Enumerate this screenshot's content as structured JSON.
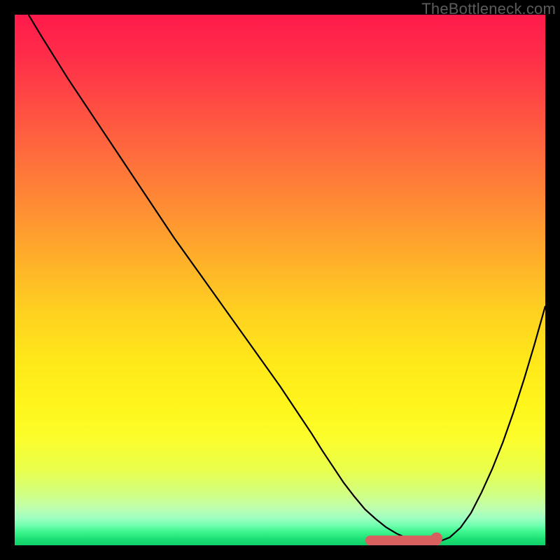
{
  "watermark": "TheBottleneck.com",
  "gradient": {
    "stops": [
      {
        "offset": 0.0,
        "color": "#ff1a4b"
      },
      {
        "offset": 0.08,
        "color": "#ff2e49"
      },
      {
        "offset": 0.16,
        "color": "#ff4944"
      },
      {
        "offset": 0.26,
        "color": "#ff6b3d"
      },
      {
        "offset": 0.36,
        "color": "#ff8c34"
      },
      {
        "offset": 0.46,
        "color": "#ffaf2a"
      },
      {
        "offset": 0.56,
        "color": "#ffd120"
      },
      {
        "offset": 0.66,
        "color": "#ffe91a"
      },
      {
        "offset": 0.74,
        "color": "#fff61c"
      },
      {
        "offset": 0.8,
        "color": "#fbfd2c"
      },
      {
        "offset": 0.86,
        "color": "#e8ff4e"
      },
      {
        "offset": 0.905,
        "color": "#d0ff85"
      },
      {
        "offset": 0.93,
        "color": "#beffaf"
      },
      {
        "offset": 0.948,
        "color": "#9fffc2"
      },
      {
        "offset": 0.962,
        "color": "#72ffb0"
      },
      {
        "offset": 0.975,
        "color": "#3cf58d"
      },
      {
        "offset": 0.988,
        "color": "#1de075"
      },
      {
        "offset": 1.0,
        "color": "#0fd068"
      }
    ]
  },
  "marker": {
    "color": "#d8605f",
    "stroke": "#d8605f",
    "radius": 8,
    "band_half_height": 7
  },
  "chart_data": {
    "type": "line",
    "title": "",
    "xlabel": "",
    "ylabel": "",
    "xlim": [
      0,
      100
    ],
    "ylim": [
      0,
      100
    ],
    "series": [
      {
        "name": "bottleneck_curve",
        "x": [
          2.6,
          5,
          10,
          15,
          20,
          25,
          30,
          35,
          40,
          45,
          50,
          53,
          56,
          58,
          60,
          62,
          64,
          66,
          68,
          70,
          72,
          74,
          76,
          78,
          80,
          82,
          84,
          86,
          88,
          90,
          92,
          94,
          96,
          98,
          100
        ],
        "y": [
          100,
          96,
          88,
          80.5,
          73,
          65.5,
          58,
          51,
          44,
          37,
          30,
          25.5,
          21,
          17.8,
          14.8,
          11.8,
          9.2,
          6.8,
          5.0,
          3.4,
          2.2,
          1.3,
          0.8,
          0.5,
          0.7,
          1.5,
          3.3,
          6.1,
          10.0,
          14.4,
          19.4,
          25.1,
          31.3,
          38.0,
          45.1
        ]
      }
    ],
    "highlight_band": {
      "x_start": 67,
      "x_end": 79.5,
      "y": 0.9
    },
    "highlight_point": {
      "x": 79.5,
      "y": 1.3
    }
  }
}
